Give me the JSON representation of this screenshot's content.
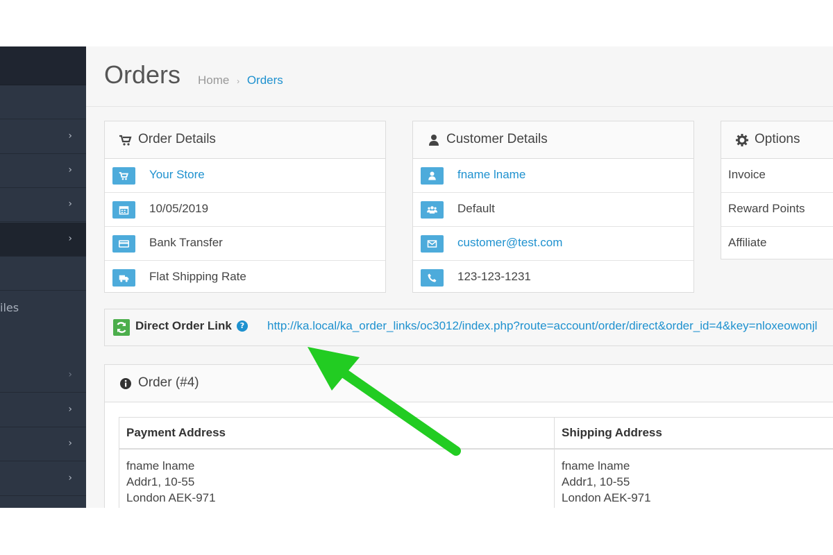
{
  "page": {
    "title": "Orders",
    "breadcrumb": {
      "home": "Home",
      "separator": "›",
      "current": "Orders"
    }
  },
  "sidebar": {
    "partial_label": "iles",
    "chevron": "›",
    "active_row_index": 3
  },
  "order_details": {
    "title": "Order Details",
    "rows": [
      {
        "icon": "cart-icon",
        "text": "Your Store",
        "is_link": true
      },
      {
        "icon": "calendar-icon",
        "text": "10/05/2019",
        "is_link": false
      },
      {
        "icon": "credit-card-icon",
        "text": "Bank Transfer",
        "is_link": false
      },
      {
        "icon": "truck-icon",
        "text": "Flat Shipping Rate",
        "is_link": false
      }
    ]
  },
  "customer_details": {
    "title": "Customer Details",
    "rows": [
      {
        "icon": "user-icon",
        "text": "fname lname",
        "is_link": true
      },
      {
        "icon": "users-icon",
        "text": "Default",
        "is_link": false
      },
      {
        "icon": "envelope-icon",
        "text": "customer@test.com",
        "is_link": true
      },
      {
        "icon": "phone-icon",
        "text": "123-123-1231",
        "is_link": false
      }
    ]
  },
  "options": {
    "title": "Options",
    "rows": [
      "Invoice",
      "Reward Points",
      "Affiliate"
    ]
  },
  "direct_order_link": {
    "label": "Direct Order Link",
    "help": "?",
    "url": "http://ka.local/ka_order_links/oc3012/index.php?route=account/order/direct&order_id=4&key=nloxeowonjl"
  },
  "order": {
    "title": "Order (#4)",
    "payment_address": {
      "header": "Payment Address",
      "lines": [
        "fname lname",
        "Addr1, 10-55",
        "London AEK-971"
      ]
    },
    "shipping_address": {
      "header": "Shipping Address",
      "lines": [
        "fname lname",
        "Addr1, 10-55",
        "London AEK-971"
      ]
    }
  },
  "colors": {
    "sidebar_bg": "#2d3644",
    "link": "#1e91cf",
    "icon_bg": "#4dabdb",
    "refresh_icon_bg": "#4cae4c",
    "annotation_arrow": "#22cc22"
  }
}
